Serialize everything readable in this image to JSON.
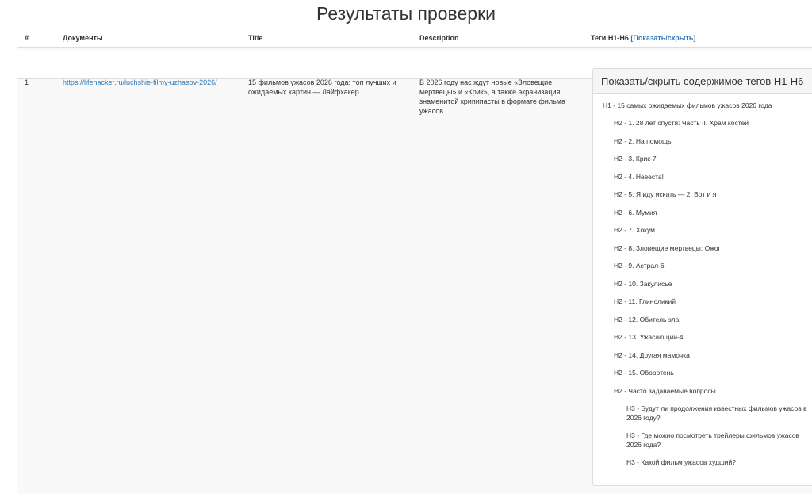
{
  "page": {
    "title": "Результаты проверки"
  },
  "table": {
    "headers": {
      "num": "#",
      "documents": "Документы",
      "title": "Title",
      "description": "Description",
      "tags": "Теги H1-H6",
      "toggle": "[Показать/скрыть]"
    },
    "rows": [
      {
        "num": "1",
        "url": "https://lifehacker.ru/luchshie-filmy-uzhasov-2026/",
        "title": "15 фильмов ужасов 2026 года: топ лучших и ожидаемых картин — Лайфхакер",
        "description": "В 2026 году нас ждут новые «Зловещие мертвецы» и «Крик», а также экранизация знаменитой крипипасты в формате фильма ужасов."
      }
    ]
  },
  "tags_panel": {
    "heading": "Показать/скрыть содержимое тегов H1-H6",
    "items": [
      {
        "level": 1,
        "text": "H1 - 15 самых ожидаемых фильмов ужасов 2026 года"
      },
      {
        "level": 2,
        "text": "H2 - 1. 28 лет спустя: Часть II. Храм костей"
      },
      {
        "level": 2,
        "text": "H2 - 2. На помощь!"
      },
      {
        "level": 2,
        "text": "H2 - 3. Крик-7"
      },
      {
        "level": 2,
        "text": "H2 - 4. Невеста!"
      },
      {
        "level": 2,
        "text": "H2 - 5. Я иду искать — 2: Вот и я"
      },
      {
        "level": 2,
        "text": "H2 - 6. Мумия"
      },
      {
        "level": 2,
        "text": "H2 - 7. Хокум"
      },
      {
        "level": 2,
        "text": "H2 - 8. Зловещие мертвецы: Ожог"
      },
      {
        "level": 2,
        "text": "H2 - 9. Астрал-6"
      },
      {
        "level": 2,
        "text": "H2 - 10. Закулисье"
      },
      {
        "level": 2,
        "text": "H2 - 11. Глиноликий"
      },
      {
        "level": 2,
        "text": "H2 - 12. Обитель зла"
      },
      {
        "level": 2,
        "text": "H2 - 13. Ужасающий-4"
      },
      {
        "level": 2,
        "text": "H2 - 14. Другая мамочка"
      },
      {
        "level": 2,
        "text": "H2 - 15. Оборотень"
      },
      {
        "level": 2,
        "text": "H2 - Часто задаваемые вопросы"
      },
      {
        "level": 3,
        "text": "H3 - Будут ли продолжения известных фильмов ужасов в 2026 году?"
      },
      {
        "level": 3,
        "text": "H3 - Где можно посмотреть трейлеры фильмов ужасов 2026 года?"
      },
      {
        "level": 3,
        "text": "H3 - Какой фильм ужасов худший?"
      }
    ]
  }
}
